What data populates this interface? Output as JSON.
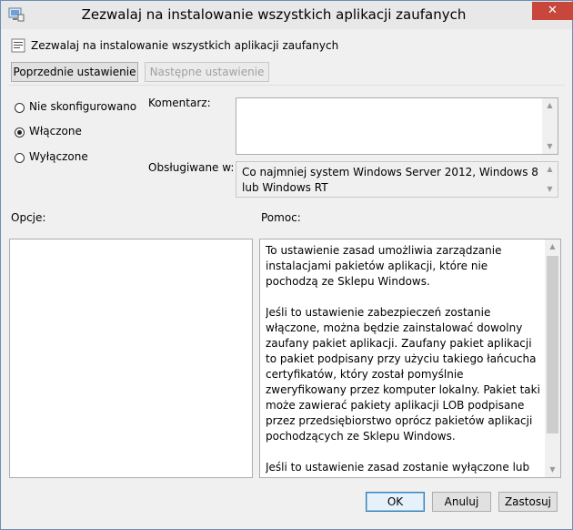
{
  "window": {
    "title": "Zezwalaj na instalowanie wszystkich aplikacji zaufanych",
    "close_glyph": "✕"
  },
  "policy": {
    "name": "Zezwalaj na instalowanie wszystkich aplikacji zaufanych"
  },
  "nav": {
    "previous_label": "Poprzednie ustawienie",
    "next_label": "Następne ustawienie"
  },
  "state": {
    "options": [
      {
        "label": "Nie skonfigurowano",
        "checked": false
      },
      {
        "label": "Włączone",
        "checked": true
      },
      {
        "label": "Wyłączone",
        "checked": false
      }
    ]
  },
  "comment": {
    "label": "Komentarz:",
    "value": ""
  },
  "supported": {
    "label": "Obsługiwane w:",
    "value": "Co najmniej system Windows Server 2012, Windows 8 lub Windows RT"
  },
  "options_panel": {
    "label": "Opcje:"
  },
  "help_panel": {
    "label": "Pomoc:",
    "text": "To ustawienie zasad umożliwia zarządzanie instalacjami pakietów aplikacji, które nie pochodzą ze Sklepu Windows.\n\nJeśli to ustawienie zabezpieczeń zostanie włączone, można będzie zainstalować dowolny zaufany pakiet aplikacji. Zaufany pakiet aplikacji to pakiet podpisany przy użyciu takiego łańcucha certyfikatów, który został pomyślnie zweryfikowany przez komputer lokalny. Pakiet taki może zawierać pakiety aplikacji LOB podpisane przez przedsiębiorstwo oprócz pakietów aplikacji pochodzących ze Sklepu Windows.\n\nJeśli to ustawienie zasad zostanie wyłączone lub pozostanie nieskonfigurowane, można instalować tylko"
  },
  "footer": {
    "ok_label": "OK",
    "cancel_label": "Anuluj",
    "apply_label": "Zastosuj"
  },
  "icons": {
    "app": "group-policy-icon",
    "policy": "policy-setting-icon",
    "scroll_up": "▲",
    "scroll_down": "▼"
  }
}
